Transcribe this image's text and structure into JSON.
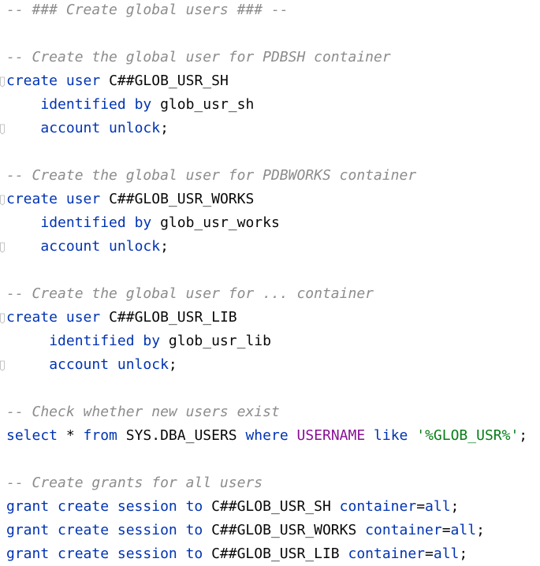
{
  "app": {
    "title": ""
  },
  "editor": {
    "lines": [
      [
        {
          "t": "cm",
          "v": "-- ### Create global users ### --"
        }
      ],
      [],
      [
        {
          "t": "cm",
          "v": "-- Create the global user for PDBSH container"
        }
      ],
      [
        {
          "t": "kw",
          "v": "create"
        },
        {
          "t": "id",
          "v": " "
        },
        {
          "t": "kw",
          "v": "user"
        },
        {
          "t": "id",
          "v": " C##GLOB_USR_SH"
        }
      ],
      [
        {
          "t": "id",
          "v": "    "
        },
        {
          "t": "kw",
          "v": "identified by"
        },
        {
          "t": "id",
          "v": " glob_usr_sh"
        }
      ],
      [
        {
          "t": "id",
          "v": "    "
        },
        {
          "t": "kw",
          "v": "account unlock"
        },
        {
          "t": "id",
          "v": ";"
        }
      ],
      [],
      [
        {
          "t": "cm",
          "v": "-- Create the global user for PDBWORKS container"
        }
      ],
      [
        {
          "t": "kw",
          "v": "create"
        },
        {
          "t": "id",
          "v": " "
        },
        {
          "t": "kw",
          "v": "user"
        },
        {
          "t": "id",
          "v": " C##GLOB_USR_WORKS"
        }
      ],
      [
        {
          "t": "id",
          "v": "    "
        },
        {
          "t": "kw",
          "v": "identified by"
        },
        {
          "t": "id",
          "v": " glob_usr_works"
        }
      ],
      [
        {
          "t": "id",
          "v": "    "
        },
        {
          "t": "kw",
          "v": "account unlock"
        },
        {
          "t": "id",
          "v": ";"
        }
      ],
      [],
      [
        {
          "t": "cm",
          "v": "-- Create the global user for ... container"
        }
      ],
      [
        {
          "t": "kw",
          "v": "create"
        },
        {
          "t": "id",
          "v": " "
        },
        {
          "t": "kw",
          "v": "user"
        },
        {
          "t": "id",
          "v": " C##GLOB_USR_LIB"
        }
      ],
      [
        {
          "t": "id",
          "v": "     "
        },
        {
          "t": "kw",
          "v": "identified by"
        },
        {
          "t": "id",
          "v": " glob_usr_lib"
        }
      ],
      [
        {
          "t": "id",
          "v": "     "
        },
        {
          "t": "kw",
          "v": "account unlock"
        },
        {
          "t": "id",
          "v": ";"
        }
      ],
      [],
      [
        {
          "t": "cm",
          "v": "-- Check whether new users exist"
        }
      ],
      [
        {
          "t": "kw",
          "v": "select"
        },
        {
          "t": "id",
          "v": " * "
        },
        {
          "t": "kw",
          "v": "from"
        },
        {
          "t": "id",
          "v": " SYS.DBA_USERS "
        },
        {
          "t": "kw",
          "v": "where"
        },
        {
          "t": "id",
          "v": " "
        },
        {
          "t": "col",
          "v": "USERNAME"
        },
        {
          "t": "id",
          "v": " "
        },
        {
          "t": "kw",
          "v": "like"
        },
        {
          "t": "id",
          "v": " "
        },
        {
          "t": "str",
          "v": "'%GLOB_USR%'"
        },
        {
          "t": "id",
          "v": ";"
        }
      ],
      [],
      [
        {
          "t": "cm",
          "v": "-- Create grants for all users"
        }
      ],
      [
        {
          "t": "kw",
          "v": "grant create session to"
        },
        {
          "t": "id",
          "v": " C##GLOB_USR_SH "
        },
        {
          "t": "kw",
          "v": "container"
        },
        {
          "t": "id",
          "v": "="
        },
        {
          "t": "kw",
          "v": "all"
        },
        {
          "t": "id",
          "v": ";"
        }
      ],
      [
        {
          "t": "kw",
          "v": "grant create session to"
        },
        {
          "t": "id",
          "v": " C##GLOB_USR_WORKS "
        },
        {
          "t": "kw",
          "v": "container"
        },
        {
          "t": "id",
          "v": "="
        },
        {
          "t": "kw",
          "v": "all"
        },
        {
          "t": "id",
          "v": ";"
        }
      ],
      [
        {
          "t": "kw",
          "v": "grant create session to"
        },
        {
          "t": "id",
          "v": " C##GLOB_USR_LIB "
        },
        {
          "t": "kw",
          "v": "container"
        },
        {
          "t": "id",
          "v": "="
        },
        {
          "t": "kw",
          "v": "all"
        },
        {
          "t": "id",
          "v": ";"
        }
      ]
    ],
    "fold_markers": [
      {
        "line": 3,
        "kind": "fold-start-icon"
      },
      {
        "line": 5,
        "kind": "fold-end-icon"
      },
      {
        "line": 8,
        "kind": "fold-start-icon"
      },
      {
        "line": 10,
        "kind": "fold-end-icon"
      },
      {
        "line": 13,
        "kind": "fold-start-icon"
      },
      {
        "line": 15,
        "kind": "fold-end-icon"
      }
    ],
    "colors": {
      "keyword": "#0033b3",
      "comment": "#8c8c8c",
      "string": "#067d17",
      "column": "#871094",
      "text": "#080808",
      "background": "#ffffff"
    }
  }
}
